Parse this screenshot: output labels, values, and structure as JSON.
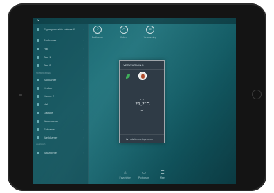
{
  "topbar": {
    "chevron": "⌄"
  },
  "sidebar": {
    "header": {
      "label": "Eigengemaakte scènes &",
      "value": ""
    },
    "rows": [
      {
        "label": "Badkamer",
        "value": ""
      },
      {
        "label": "Hal",
        "value": ""
      },
      {
        "label": "Bad 1",
        "value": ""
      },
      {
        "label": "Bad 2",
        "value": ""
      }
    ],
    "section1": "Verdieping",
    "rows2": [
      {
        "label": "Badkamer",
        "value": ""
      },
      {
        "label": "Keuken",
        "value": ""
      },
      {
        "label": "Kamer 2",
        "value": ""
      },
      {
        "label": "Hal",
        "value": ""
      },
      {
        "label": "Garage",
        "value": ""
      },
      {
        "label": "Woonkamer",
        "value": ""
      },
      {
        "label": "Eetkamer",
        "value": ""
      },
      {
        "label": "Werkkamer",
        "value": ""
      }
    ],
    "section2": "Overig",
    "rows3": [
      {
        "label": "Wasruimte",
        "value": ""
      }
    ]
  },
  "tabs": [
    {
      "label": "Badkamer",
      "icon": "?"
    },
    {
      "label": "Koken",
      "icon": "⌂"
    },
    {
      "label": "Verwarming",
      "icon": "≡"
    }
  ],
  "card": {
    "title": "VERWARMING",
    "small_label": "i",
    "temperature": "21,2°C",
    "up": "︿",
    "down": "﹀",
    "footer_icon": "⇆",
    "footer_text": "Als favoriet opnemen"
  },
  "bottombar": [
    {
      "label": "Favorieten",
      "icon": "☆"
    },
    {
      "label": "Pictogram",
      "icon": "▭"
    },
    {
      "label": "Meer",
      "icon": "☰"
    }
  ],
  "colors": {
    "screen": "#16666f",
    "card": "#2f3b46",
    "leaf": "#3fae5a",
    "flame": "#b04a2a"
  }
}
